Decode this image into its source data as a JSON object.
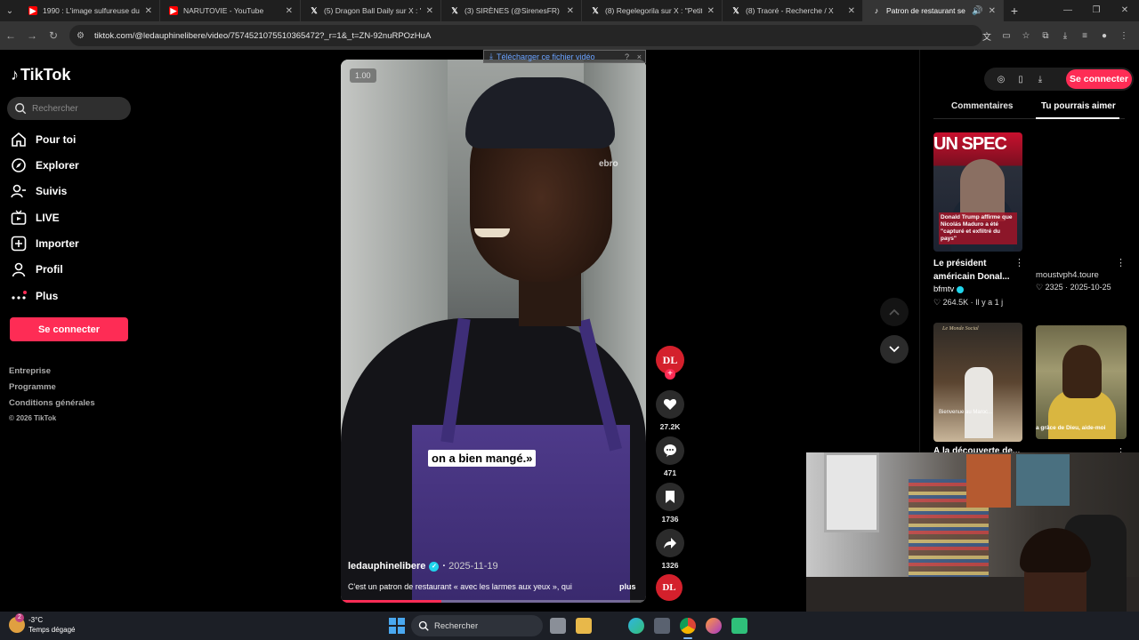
{
  "browser": {
    "tabs": [
      {
        "title": "1990 : L'image sulfureuse du ra",
        "icon": "youtube-icon"
      },
      {
        "title": "NARUTOVIE - YouTube",
        "icon": "youtube-icon"
      },
      {
        "title": "(5) Dragon Ball Daily sur X : \"W",
        "icon": "x-icon"
      },
      {
        "title": "(3) SIRÈNES (@SirenesFR) / X",
        "icon": "x-icon"
      },
      {
        "title": "(8) Regelegorila sur X : \"Petite l",
        "icon": "x-icon"
      },
      {
        "title": "(8) Traoré - Recherche / X",
        "icon": "x-icon"
      },
      {
        "title": "Patron de restaurant se bat",
        "icon": "tiktok-icon"
      }
    ],
    "url": "tiktok.com/@ledauphinelibere/video/7574521075510365472?_r=1&_t=ZN-92nuRPOzHuA"
  },
  "sidebar": {
    "logo": "TikTok",
    "search_placeholder": "Rechercher",
    "items": [
      {
        "label": "Pour toi",
        "icon": "home-icon"
      },
      {
        "label": "Explorer",
        "icon": "compass-icon"
      },
      {
        "label": "Suivis",
        "icon": "following-icon"
      },
      {
        "label": "LIVE",
        "icon": "live-icon"
      },
      {
        "label": "Importer",
        "icon": "upload-icon"
      },
      {
        "label": "Profil",
        "icon": "profile-icon"
      },
      {
        "label": "Plus",
        "icon": "more-icon"
      }
    ],
    "login_label": "Se connecter",
    "footer_links": [
      "Entreprise",
      "Programme",
      "Conditions générales"
    ],
    "copyright": "© 2026 TikTok"
  },
  "video": {
    "speed": "1.00",
    "watermark": "ebro",
    "caption": "on a bien mangé.»",
    "author": "ledauphinelibere",
    "date": "2025-11-19",
    "description": "C'est un patron de restaurant « avec les larmes aux yeux », qui",
    "more_label": "plus",
    "progress": 0.33,
    "download_banner": "Télécharger ce fichier vidéo",
    "download_help": "?",
    "download_close": "×"
  },
  "actions": {
    "avatar_text": "DL",
    "likes": "27.2K",
    "comments": "471",
    "saves": "1736",
    "shares": "1326"
  },
  "right_panel": {
    "login_label": "Se connecter",
    "tabs": [
      "Commentaires",
      "Tu pourrais aimer"
    ],
    "active_tab": "Tu pourrais aimer",
    "cards": [
      {
        "thumb_heading": "UN SPEC",
        "thumb_caption": "Donald Trump affirme que Nicolás Maduro a été \"capturé et exfiltré du pays\"",
        "title": "Le président américain Donal...",
        "author": "bfmtv",
        "likes": "264.5K",
        "age": "Il y a 1 j"
      },
      {
        "author": "moustvph4.toure",
        "likes": "2325",
        "date": "2025-10-25"
      },
      {
        "thumb_sign": "Le Monde Social",
        "thumb_caption": "Bienvenue au Maroc...",
        "title": "À la découverte de..."
      },
      {
        "thumb_caption": "a grâce de Dieu, aide-moi"
      }
    ]
  },
  "taskbar": {
    "temperature": "-3°C",
    "weather": "Temps dégagé",
    "weather_badge": "2",
    "search_label": "Rechercher"
  },
  "colors": {
    "accent": "#fe2c55",
    "verified": "#20d5ec",
    "page_bg": "#000000"
  }
}
